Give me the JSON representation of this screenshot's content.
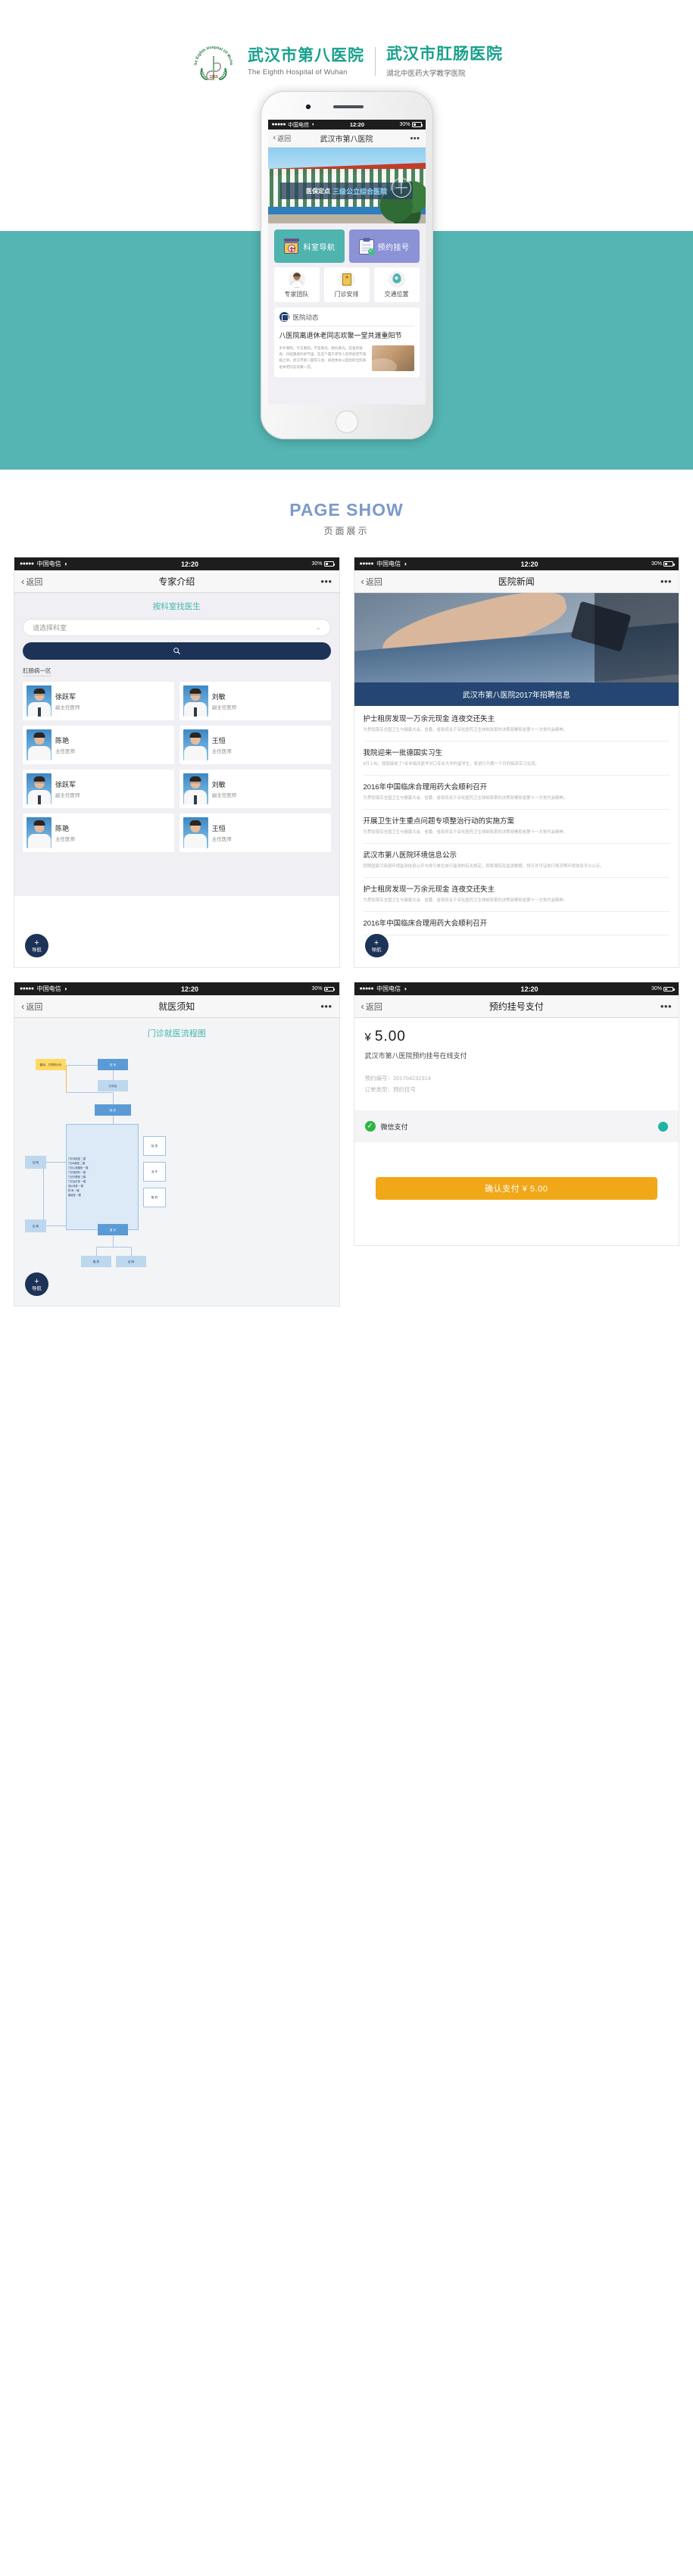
{
  "header": {
    "brand_cn": "武汉市第八医院",
    "brand_en": "The Eighth Hospital of Wuhan",
    "brand_cn2": "武汉市肛肠医院",
    "brand_sub2": "湖北中医药大学教学医院",
    "logo_year": "1953",
    "logo_arc_text": "The Eighth Hospital of Wuhan",
    "accent_color": "#17a08c"
  },
  "status_bar": {
    "signal_dots": "●●●●●",
    "carrier": "中国电信",
    "wifi_icon": "wifi-icon",
    "time": "12:20",
    "battery": "30%"
  },
  "hero_screen": {
    "nav": {
      "back": "返回",
      "title": "武汉市第八医院",
      "more": "•••"
    },
    "banner": {
      "prefix": "医保定点",
      "highlight": "三级公立综合医院"
    },
    "primary_tiles": [
      {
        "label": "科室导航",
        "icon": "department-sign-icon",
        "color": "#4fb3ae"
      },
      {
        "label": "预约挂号",
        "icon": "clipboard-check-icon",
        "color": "#8b92d6"
      }
    ],
    "secondary_tiles": [
      {
        "label": "专家团队",
        "icon": "doctor-avatar-icon"
      },
      {
        "label": "门诊安排",
        "icon": "schedule-book-icon"
      },
      {
        "label": "交通位置",
        "icon": "map-pin-icon"
      }
    ],
    "news": {
      "section_icon": "news-book-icon",
      "section_label": "医院动态",
      "headline": "八医院离退休老同志欢聚一堂共渡重阳节",
      "excerpt": "岁岁重阳，今又重阳。不是春光，胜似春光。在金风送爽、丹桂飘香的季节里，在这个属于老年人的传统佳节来临之际，武汉市第八医院工会、离退休办公室组织全院离退休老同志欢聚一堂。",
      "thumb_icon": "news-photo-thumb"
    }
  },
  "page_show": {
    "en": "PAGE SHOW",
    "cn": "页面展示"
  },
  "screen_experts": {
    "nav": {
      "back": "返回",
      "title": "专家介绍",
      "more": "•••"
    },
    "section_title": "按科室找医生",
    "select_placeholder": "请选择科室",
    "select_chevron": "chevron-down-icon",
    "search_icon": "search-icon",
    "dept_label": "肛肠病一区",
    "doctors": [
      {
        "name": "徐跃军",
        "title": "副主任医师"
      },
      {
        "name": "刘敏",
        "title": "副主任医师"
      },
      {
        "name": "陈艳",
        "title": "主任医师"
      },
      {
        "name": "王恒",
        "title": "主任医师"
      },
      {
        "name": "徐跃军",
        "title": "副主任医师"
      },
      {
        "name": "刘敏",
        "title": "副主任医师"
      },
      {
        "name": "陈艳",
        "title": "主任医师"
      },
      {
        "name": "王恒",
        "title": "主任医师"
      }
    ],
    "fab": {
      "plus": "+",
      "label": "导航"
    }
  },
  "screen_news": {
    "nav": {
      "back": "返回",
      "title": "医院新闻",
      "more": "•••"
    },
    "hero_icon": "ultrasound-photo",
    "banner": "武汉市第八医院2017年招聘信息",
    "items": [
      {
        "title": "护士租房发现一万余元现金 连夜交还失主",
        "desc": "为贯彻落实全国卫生与健康大会、省委、省政府关于深化医药卫生体制改革的决策部署和省第十一次党代会精神。"
      },
      {
        "title": "我院迎来一批德国实习生",
        "desc": "8月上旬，我院接收了7名非临床医学对口专业大学的留学生，将进行为期一个月的临床实习交流。"
      },
      {
        "title": "2016年中国临床合理用药大会顺利召开",
        "desc": "为贯彻落实全国卫生与健康大会、省委、省政府关于深化医药卫生体制改革的决策部署和省第十一次党代会精神。"
      },
      {
        "title": "开展卫生计生重点问题专项整治行动的实施方案",
        "desc": "为贯彻落实全国卫生与健康大会、省委、省政府关于深化医药卫生体制改革的决策部署和省第十一次党代会精神。"
      },
      {
        "title": "武汉市第八医院环境信息公示",
        "desc": "按照国家污染源环境监测信息公开与排污单位自行监测的有关规定，现将我院及监测数据、排污许可证执行情况等环境信息予以公示。"
      },
      {
        "title": "护士租房发现一万余元现金 连夜交还失主",
        "desc": "为贯彻落实全国卫生与健康大会、省委、省政府关于深化医药卫生体制改革的决策部署和省第十一次党代会精神。"
      },
      {
        "title": "2016年中国临床合理用药大会顺利召开",
        "desc": ""
      }
    ],
    "fab": {
      "plus": "+",
      "label": "导航"
    }
  },
  "screen_guide": {
    "nav": {
      "back": "返回",
      "title": "就医须知",
      "more": "•••"
    },
    "flow_title": "门诊就医流程图",
    "nodes": [
      "翻译、打预防针处",
      "挂 号",
      "分诊台",
      "就 诊",
      "门诊化验室  二楼",
      "门诊B超室  二楼",
      "门诊心电图室  一楼",
      "门诊放射科  一楼",
      "门诊内镜室  三楼",
      "门诊治疗室  一楼",
      "划价收费  一楼",
      "药 房  一楼",
      "输液室  一楼",
      "住 院",
      "出 院",
      "取 药",
      "检 查",
      "治 疗",
      "复 诊"
    ],
    "fab": {
      "plus": "+",
      "label": "导航"
    }
  },
  "screen_pay": {
    "nav": {
      "back": "返回",
      "title": "预约挂号支付",
      "more": "•••"
    },
    "currency": "¥",
    "amount": "5.00",
    "description": "武汉市第八医院预约挂号在线支付",
    "meta": [
      {
        "label": "预约编号：",
        "value": "201704232314"
      },
      {
        "label": "订单类型：",
        "value": "预约挂号"
      }
    ],
    "method": {
      "icon": "wechat-pay-icon",
      "label": "微信支付",
      "selected": true
    },
    "confirm_button": "确认支付 ¥ 5.00"
  }
}
